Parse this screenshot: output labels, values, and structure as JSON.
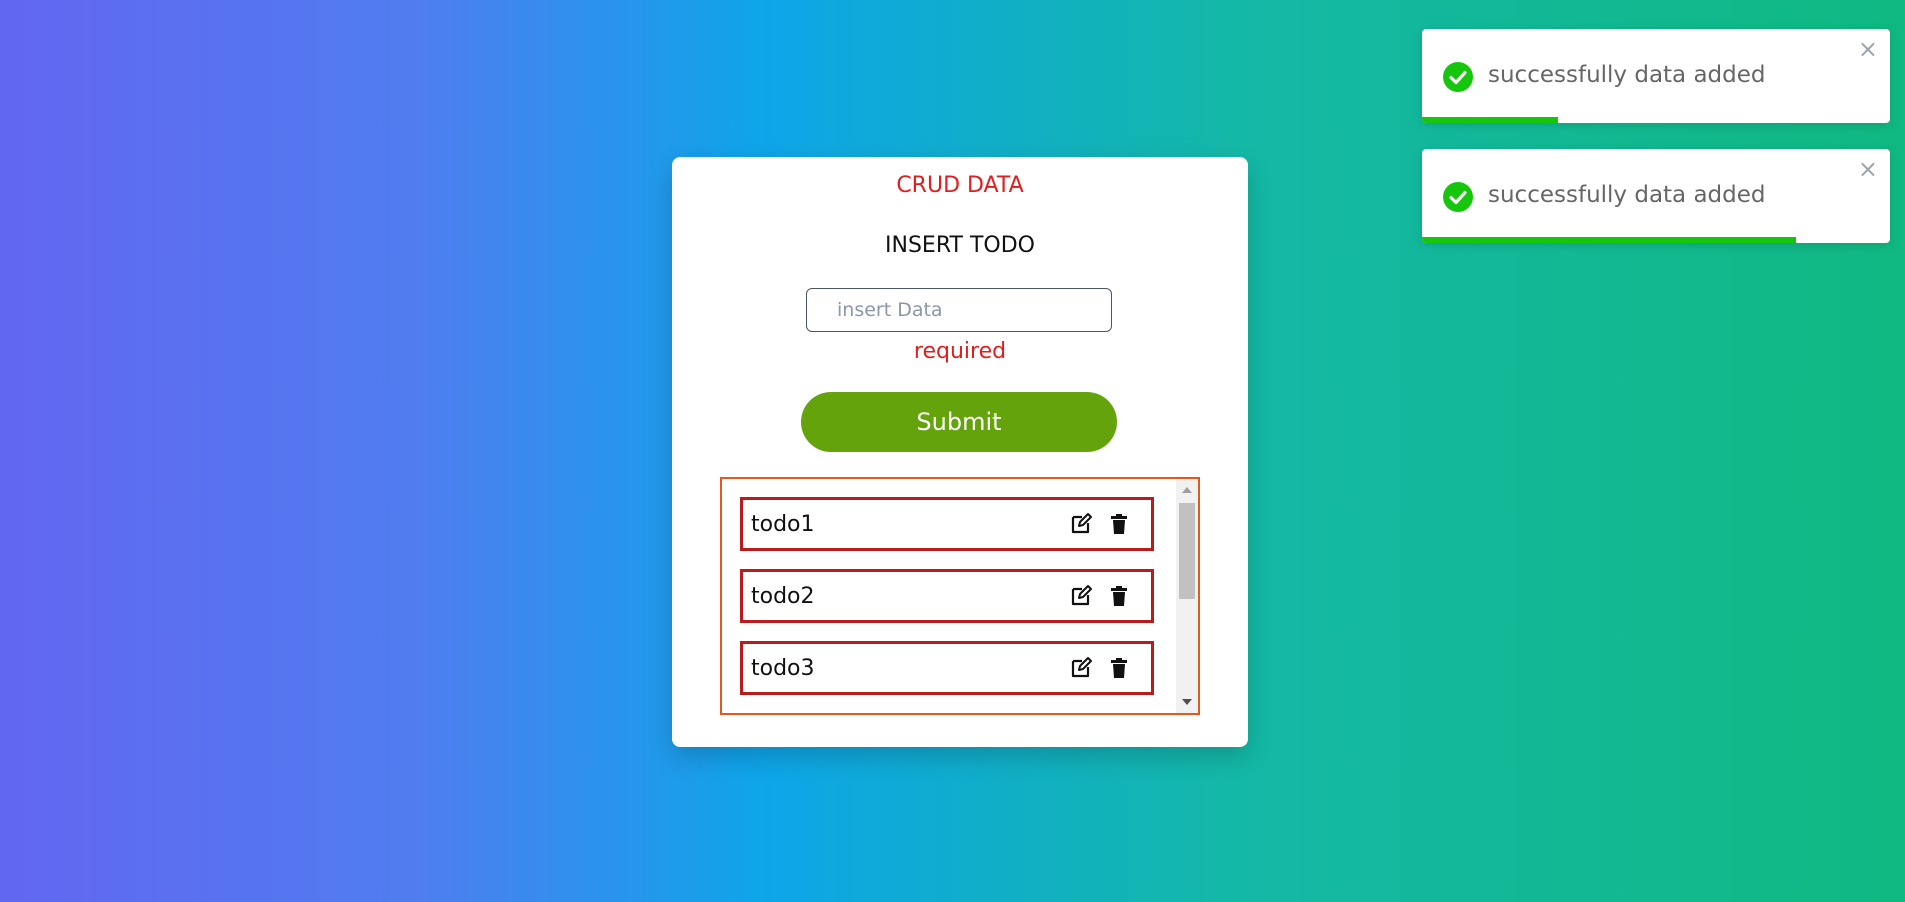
{
  "app": {
    "title": "CRUD DATA",
    "section_title": "INSERT TODO"
  },
  "form": {
    "input_placeholder": "insert Data",
    "input_value": "",
    "validation_message": "required",
    "submit_label": "Submit"
  },
  "todos": [
    {
      "label": "todo1",
      "edit_icon": "edit-icon",
      "delete_icon": "trash-icon"
    },
    {
      "label": "todo2",
      "edit_icon": "edit-icon",
      "delete_icon": "trash-icon"
    },
    {
      "label": "todo3",
      "edit_icon": "edit-icon",
      "delete_icon": "trash-icon"
    }
  ],
  "toasts": [
    {
      "message": "successfully data added",
      "close_label": "×",
      "progress_remaining": 0.29,
      "icon": "check-circle-icon"
    },
    {
      "message": "successfully data added",
      "close_label": "×",
      "progress_remaining": 0.8,
      "icon": "check-circle-icon"
    }
  ],
  "colors": {
    "accent_red": "#e11d1d",
    "submit_green": "#65a30d",
    "list_border": "#e2581d",
    "item_border": "#b91c1c",
    "toast_success": "#16c60c",
    "background_start": "#6366f1",
    "background_mid": "#0ea5e9",
    "background_end": "#10b981"
  }
}
